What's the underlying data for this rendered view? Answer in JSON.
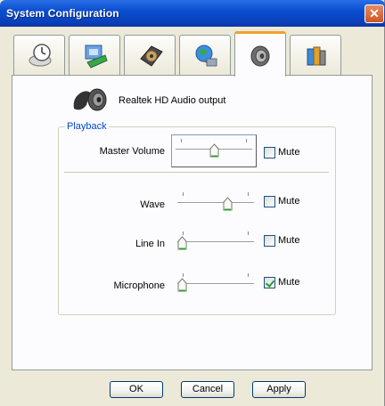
{
  "window": {
    "title": "System Configuration",
    "close_glyph": "✕"
  },
  "tabs": [
    {
      "icon": "clock-icon",
      "active": false
    },
    {
      "icon": "display-icon",
      "active": false
    },
    {
      "icon": "hard-drive-icon",
      "active": false
    },
    {
      "icon": "globe-network-icon",
      "active": false
    },
    {
      "icon": "speaker-icon",
      "active": true
    },
    {
      "icon": "books-icon",
      "active": false
    }
  ],
  "device": {
    "label": "Realtek HD Audio output",
    "icon": "speaker-icon"
  },
  "playback": {
    "title": "Playback",
    "master": {
      "label": "Master Volume",
      "level": 0.5,
      "mute_label": "Mute",
      "muted": false
    },
    "channels": [
      {
        "label": "Wave",
        "level": 0.68,
        "mute_label": "Mute",
        "muted": false
      },
      {
        "label": "Line In",
        "level": 0.0,
        "mute_label": "Mute",
        "muted": false
      },
      {
        "label": "Microphone",
        "level": 0.0,
        "mute_label": "Mute",
        "muted": true
      }
    ]
  },
  "buttons": {
    "ok": "OK",
    "cancel": "Cancel",
    "apply": "Apply"
  },
  "colors": {
    "title_bar": "#0a4ed0",
    "group_title": "#0046d5",
    "active_tab_accent": "#f0a02a",
    "thumb_green": "#2ea02e"
  }
}
